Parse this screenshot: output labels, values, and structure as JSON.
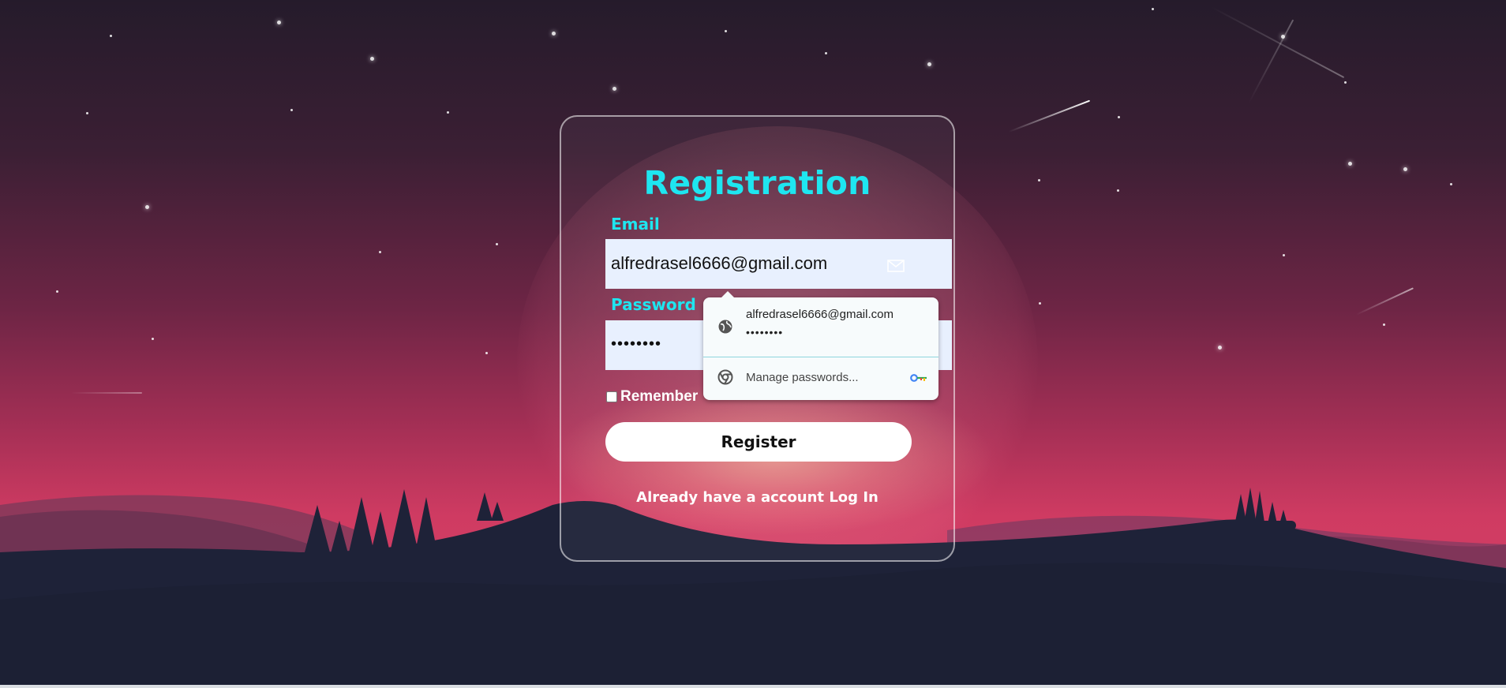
{
  "form": {
    "title": "Registration",
    "email_label": "Email",
    "email_value": "alfredrasel6666@gmail.com",
    "password_label": "Password",
    "password_value": "••••••••",
    "remember_label": "Remember",
    "register_label": "Register",
    "footer_text": "Already have a account",
    "login_link": "Log In"
  },
  "autofill": {
    "suggestion_email": "alfredrasel6666@gmail.com",
    "suggestion_password": "••••••••",
    "manage_label": "Manage passwords..."
  },
  "colors": {
    "accent": "#1ee6f0",
    "input_bg": "#e8f0fe",
    "card_border": "#ffffff"
  }
}
